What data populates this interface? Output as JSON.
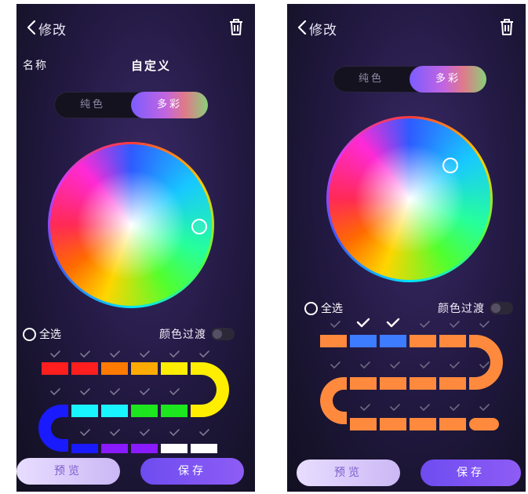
{
  "left_screen": {
    "title": "修改",
    "name_label": "名称",
    "name_value": "自定义",
    "segment": {
      "solid_label": "纯色",
      "multi_label": "多彩",
      "active": "multi"
    },
    "select_all_label": "全选",
    "transition_label": "颜色过渡",
    "transition_on": false,
    "buttons": {
      "preview": "预览",
      "save": "保存"
    }
  },
  "right_screen": {
    "title": "修改",
    "segment": {
      "solid_label": "纯色",
      "multi_label": "多彩",
      "active": "multi"
    },
    "select_all_label": "全选",
    "transition_label": "颜色过渡",
    "transition_on": false,
    "buttons": {
      "preview": "预览",
      "save": "保存"
    }
  },
  "colors": {
    "segment_red": "#ff1e1e",
    "segment_orange": "#ff7a00",
    "segment_amber": "#ffaa00",
    "segment_yellow": "#ffee00",
    "segment_cyan": "#19f5ff",
    "segment_green": "#1ee61e",
    "segment_blue": "#1a1aff",
    "segment_purple": "#8a1aff",
    "segment_white": "#ffffff",
    "strip_orange": "#ff8a3d",
    "strip_selected_blue": "#3d7bff",
    "accent_purple": "#7c5cff"
  }
}
